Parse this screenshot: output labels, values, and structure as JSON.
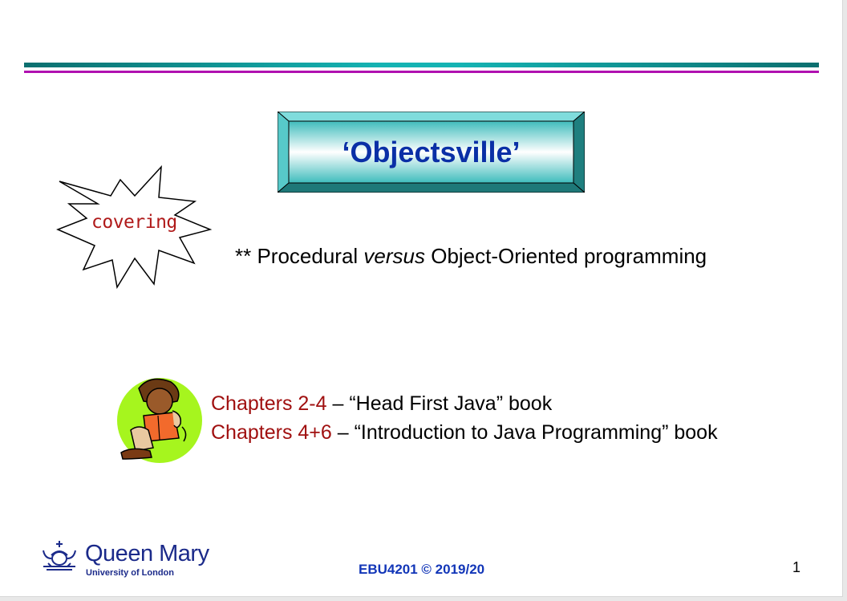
{
  "slide": {
    "title": "‘Objectsville’",
    "burst_label": "covering",
    "bullet": {
      "prefix": "** Procedural ",
      "emphasis": "versus",
      "suffix": " Object-Oriented programming"
    },
    "references": [
      {
        "chapters": "Chapters 2-4",
        "text": " – “Head First Java” book"
      },
      {
        "chapters": "Chapters 4+6",
        "text": " – “Introduction to Java Programming” book"
      }
    ],
    "footer": "EBU4201 © 2019/20",
    "page_number": "1"
  },
  "logo": {
    "name": "Queen Mary",
    "subtitle": "University of London"
  },
  "colors": {
    "title_text": "#0a2fa6",
    "title_box": "#4fc7c7",
    "rule_teal": "#14b3b3",
    "rule_magenta": "#b010b0",
    "reference_chapters": "#a01010",
    "burst_text": "#b01a1a",
    "footer_text": "#1236b8",
    "logo": "#1b2a8a"
  }
}
